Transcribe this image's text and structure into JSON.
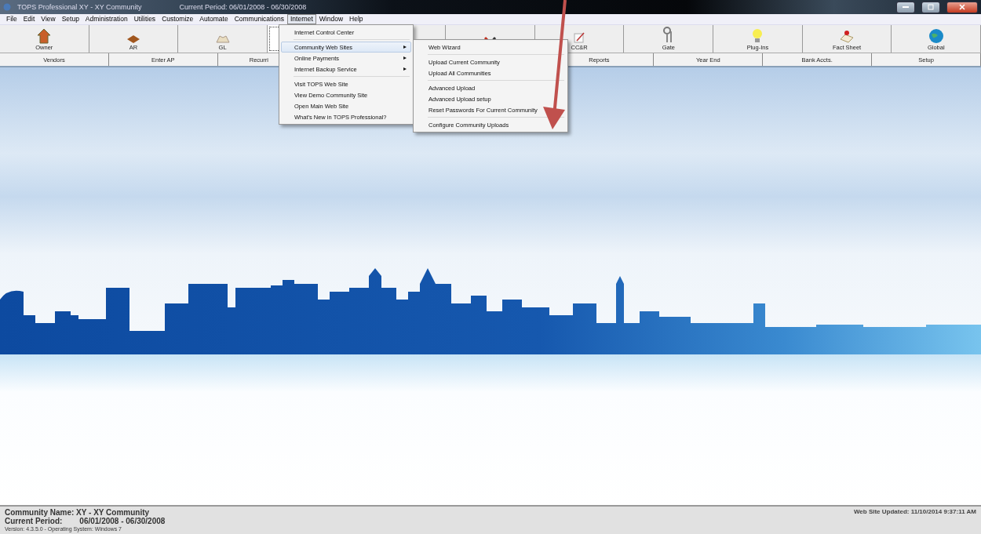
{
  "window": {
    "title": "TOPS Professional  XY - XY Community",
    "period": "Current Period: 06/01/2008 - 06/30/2008"
  },
  "menu_bar": [
    {
      "label": "File",
      "selected": false
    },
    {
      "label": "Edit",
      "selected": false
    },
    {
      "label": "View",
      "selected": false
    },
    {
      "label": "Setup",
      "selected": false
    },
    {
      "label": "Administration",
      "selected": false
    },
    {
      "label": "Utilities",
      "selected": false
    },
    {
      "label": "Customize",
      "selected": false
    },
    {
      "label": "Automate",
      "selected": false
    },
    {
      "label": "Communications",
      "selected": false
    },
    {
      "label": "Internet",
      "selected": true
    },
    {
      "label": "Window",
      "selected": false
    },
    {
      "label": "Help",
      "selected": false
    }
  ],
  "toolbar": [
    {
      "label": "Owner",
      "selected": false
    },
    {
      "label": "AR",
      "selected": false
    },
    {
      "label": "GL",
      "selected": false
    },
    {
      "selected": true
    },
    {
      "selected": false
    },
    {
      "selected": false
    },
    {
      "label": "CC&R",
      "selected": false
    },
    {
      "label": "Gate",
      "selected": false
    },
    {
      "label": "Plug-Ins",
      "selected": false
    },
    {
      "label": "Fact Sheet",
      "selected": false
    },
    {
      "label": "Global",
      "selected": false
    }
  ],
  "subbar": [
    {
      "label": "Vendors"
    },
    {
      "label": "Enter AP"
    },
    {
      "label": "Recurri"
    },
    {
      "label": "Reports"
    },
    {
      "label": "Year End"
    },
    {
      "label": "Bank Accts."
    },
    {
      "label": "Setup"
    }
  ],
  "internet_menu": [
    {
      "kind": "item",
      "label": "Internet Control Center",
      "selected": false
    },
    {
      "kind": "separator"
    },
    {
      "kind": "submenu",
      "label": "Community Web Sites",
      "arrow": "▸",
      "selected": true
    },
    {
      "kind": "submenu",
      "label": "Online Payments",
      "arrow": "▸",
      "selected": false
    },
    {
      "kind": "submenu",
      "label": "Internet Backup Service",
      "arrow": "▸",
      "selected": false
    },
    {
      "kind": "separator"
    },
    {
      "kind": "item",
      "label": "Visit TOPS Web Site",
      "selected": false
    },
    {
      "kind": "item",
      "label": "View Demo Community Site",
      "selected": false
    },
    {
      "kind": "item",
      "label": "Open Main Web Site",
      "selected": false
    },
    {
      "kind": "item",
      "label": "What's New in TOPS Professional?",
      "selected": false
    }
  ],
  "community_submenu": [
    {
      "kind": "item",
      "label": "Web Wizard"
    },
    {
      "kind": "separator"
    },
    {
      "kind": "item",
      "label": "Upload Current Community"
    },
    {
      "kind": "item",
      "label": "Upload All Communities"
    },
    {
      "kind": "separator"
    },
    {
      "kind": "item",
      "label": "Advanced Upload"
    },
    {
      "kind": "item",
      "label": "Advanced Upload setup"
    },
    {
      "kind": "item",
      "label": "Reset Passwords For Current Community"
    },
    {
      "kind": "separator"
    },
    {
      "kind": "item",
      "label": "Configure Community Uploads"
    }
  ],
  "status_bar": {
    "community": "Community Name: XY - XY Community",
    "period_label": "Current Period:",
    "period": "06/01/2008 - 06/30/2008",
    "version": "Version: 4.3.5.0  -  Operating System: Windows 7",
    "updated": "Web Site Updated: 11/10/2014 9:37:11 AM"
  }
}
